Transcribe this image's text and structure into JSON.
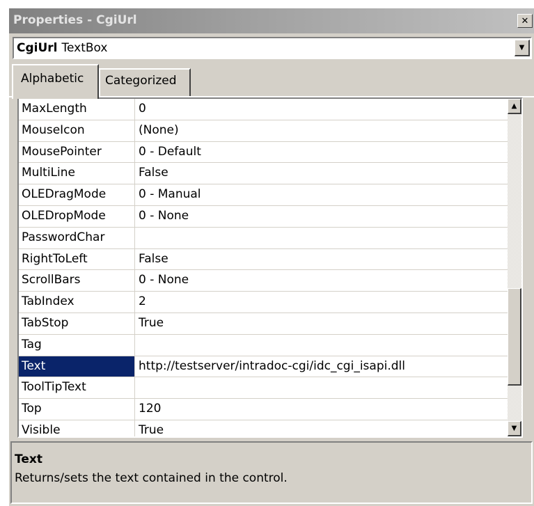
{
  "window": {
    "title": "Properties - CgiUrl",
    "close_glyph": "✕"
  },
  "object_selector": {
    "name": "CgiUrl",
    "type": "TextBox",
    "dropdown_glyph": "▼"
  },
  "tabs": [
    {
      "label": "Alphabetic",
      "selected": true
    },
    {
      "label": "Categorized",
      "selected": false
    }
  ],
  "properties": [
    {
      "name": "MaxLength",
      "value": "0"
    },
    {
      "name": "MouseIcon",
      "value": "(None)"
    },
    {
      "name": "MousePointer",
      "value": "0 - Default"
    },
    {
      "name": "MultiLine",
      "value": "False"
    },
    {
      "name": "OLEDragMode",
      "value": "0 - Manual"
    },
    {
      "name": "OLEDropMode",
      "value": "0 - None"
    },
    {
      "name": "PasswordChar",
      "value": ""
    },
    {
      "name": "RightToLeft",
      "value": "False"
    },
    {
      "name": "ScrollBars",
      "value": "0 - None"
    },
    {
      "name": "TabIndex",
      "value": "2"
    },
    {
      "name": "TabStop",
      "value": "True"
    },
    {
      "name": "Tag",
      "value": ""
    },
    {
      "name": "Text",
      "value": "http://testserver/intradoc-cgi/idc_cgi_isapi.dll",
      "selected": true
    },
    {
      "name": "ToolTipText",
      "value": ""
    },
    {
      "name": "Top",
      "value": "120"
    },
    {
      "name": "Visible",
      "value": "True"
    }
  ],
  "scrollbar": {
    "up_glyph": "▲",
    "down_glyph": "▼"
  },
  "description": {
    "title": "Text",
    "text": "Returns/sets the text contained in the control."
  },
  "colors": {
    "selection": "#0a246a",
    "face": "#d4d0c8",
    "title_gradient_start": "#808080",
    "title_gradient_end": "#c0c0c0"
  }
}
